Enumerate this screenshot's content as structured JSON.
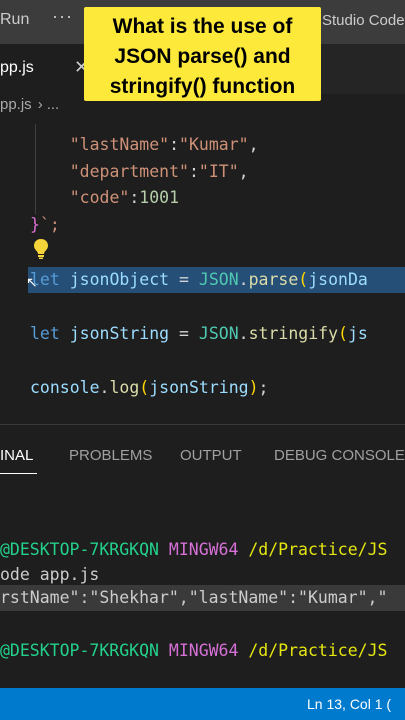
{
  "titlebar": {
    "menu_run": "Run",
    "more_glyph": "···",
    "window_title": "Studio Code"
  },
  "banner": {
    "lines": [
      "What is the use of",
      "JSON parse() and",
      "stringify() function"
    ],
    "color": "#fce93a"
  },
  "tab": {
    "label": "pp.js",
    "close_glyph": "✕"
  },
  "breadcrumb": {
    "file": "pp.js",
    "separator": "›",
    "more": "..."
  },
  "editor": {
    "lines": {
      "l1_key": "\"lastName\"",
      "l1_colon": ":",
      "l1_val": "\"Kumar\"",
      "l1_comma": ",",
      "l2_key": "\"department\"",
      "l2_colon": ":",
      "l2_val": "\"IT\"",
      "l2_comma": ",",
      "l3_key": "\"code\"",
      "l3_colon": ":",
      "l3_val": "1001",
      "l4_brace": "}",
      "l4_end": "`;",
      "l5_kw": "let",
      "l5_var": " jsonObject",
      "l5_eq": " = ",
      "l5_cls": "JSON",
      "l5_dot": ".",
      "l5_fn": "parse",
      "l5_paren": "(",
      "l5_arg": "jsonDa",
      "l6_kw": "let",
      "l6_var": " jsonString",
      "l6_eq": " = ",
      "l6_cls": "JSON",
      "l6_dot": ".",
      "l6_fn": "stringify",
      "l6_paren": "(",
      "l6_arg": "js",
      "l7_obj": "console",
      "l7_dot": ".",
      "l7_fn": "log",
      "l7_paren_open": "(",
      "l7_arg": "jsonString",
      "l7_paren_close": ")",
      "l7_end": ";"
    }
  },
  "panel": {
    "tabs": {
      "terminal": "INAL",
      "problems": "PROBLEMS",
      "output": "OUTPUT",
      "debug": "DEBUG CONSOLE"
    },
    "terminal": {
      "prompt1_user": "@DESKTOP-7KRGKQN",
      "prompt1_env": " MINGW64",
      "prompt1_path": " /d/Practice/JS",
      "command": "ode app.js",
      "output": "rstName\":\"Shekhar\",\"lastName\":\"Kumar\",\"",
      "prompt2_user": "@DESKTOP-7KRGKQN",
      "prompt2_env": " MINGW64",
      "prompt2_path": " /d/Practice/JS"
    }
  },
  "statusbar": {
    "position": "Ln 13, Col 1 (",
    "color": "#007acc"
  }
}
